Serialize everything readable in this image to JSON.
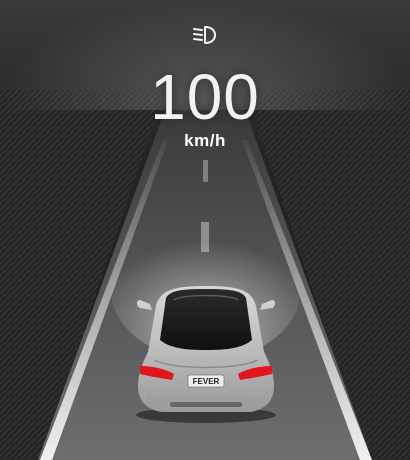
{
  "indicators": {
    "headlight_icon": "low-beam-headlight-icon"
  },
  "speed": {
    "value": "100",
    "unit": "km/h"
  },
  "vehicle": {
    "plate": "FEVER",
    "color": "silver"
  },
  "colors": {
    "accent_lane_light": "#e8e8e8",
    "tail_light": "#e0161c",
    "background": "#1c1c1c"
  }
}
